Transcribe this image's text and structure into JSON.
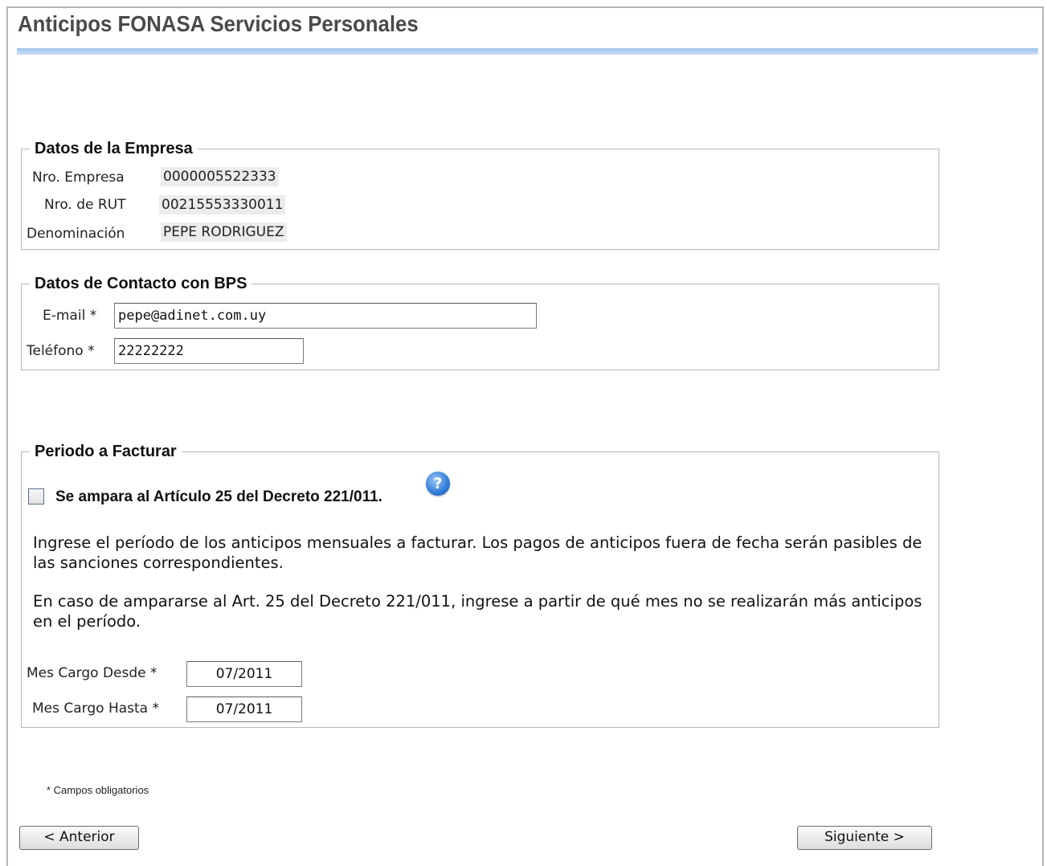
{
  "page": {
    "title": "Anticipos FONASA Servicios Personales"
  },
  "empresa": {
    "legend": "Datos de la Empresa",
    "nro_empresa_label": "Nro. Empresa",
    "nro_empresa_value": "0000005522333",
    "rut_label": "Nro. de RUT",
    "rut_value": "00215553330011",
    "denominacion_label": "Denominación",
    "denominacion_value": "PEPE RODRIGUEZ"
  },
  "contacto": {
    "legend": "Datos de Contacto con BPS",
    "email_label": "E-mail *",
    "email_value": "pepe@adinet.com.uy",
    "telefono_label": "Teléfono *",
    "telefono_value": "22222222"
  },
  "periodo": {
    "legend": "Periodo a Facturar",
    "checkbox_label": "Se ampara al Artículo 25 del Decreto 221/011.",
    "checkbox_checked": false,
    "help_glyph": "?",
    "paragraph1": "Ingrese el período de los anticipos mensuales a facturar. Los pagos de anticipos fuera de fecha serán pasibles de las sanciones correspondientes.",
    "paragraph2": "En caso de ampararse al Art. 25 del Decreto 221/011, ingrese a partir de qué mes no se realizarán más anticipos en el período.",
    "desde_label": "Mes Cargo Desde *",
    "desde_value": "07/2011",
    "hasta_label": "Mes Cargo Hasta *",
    "hasta_value": "07/2011"
  },
  "footer": {
    "required_note": "* Campos obligatorios",
    "prev_button": "< Anterior",
    "next_button": "Siguiente >"
  },
  "colors": {
    "title_rule": "#9fc3ec",
    "help_icon": "#2f7bd6",
    "title_text": "#4a4a4a"
  }
}
